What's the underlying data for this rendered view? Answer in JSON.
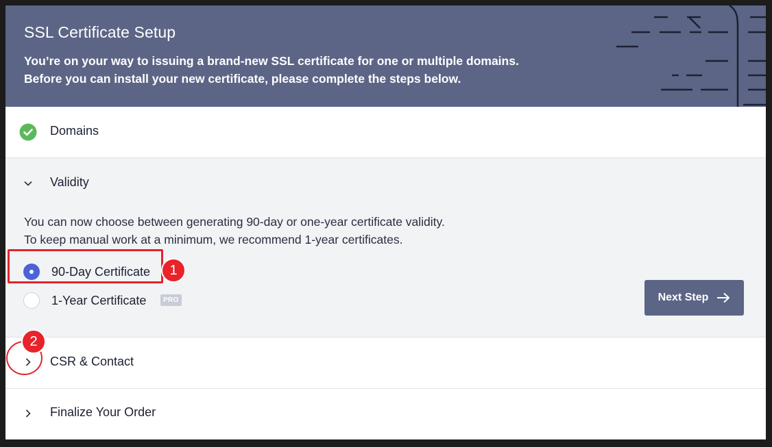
{
  "header": {
    "title": "SSL Certificate Setup",
    "desc_line1": "You’re on your way to issuing a brand-new SSL certificate for one or multiple domains.",
    "desc_line2": "Before you can install your new certificate, please complete the steps below."
  },
  "steps": {
    "domains": {
      "label": "Domains",
      "icon": "check-circle-icon",
      "status": "complete"
    },
    "validity": {
      "label": "Validity",
      "icon": "chevron-down-icon",
      "text_line1": "You can now choose between generating 90-day or one-year certificate validity.",
      "text_line2": "To keep manual work at a minimum, we recommend 1-year certificates.",
      "options": [
        {
          "label": "90-Day Certificate",
          "selected": true
        },
        {
          "label": "1-Year Certificate",
          "selected": false,
          "badge": "PRO"
        }
      ],
      "next_button": "Next Step"
    },
    "csr": {
      "label": "CSR & Contact",
      "icon": "chevron-right-icon"
    },
    "finalize": {
      "label": "Finalize Your Order",
      "icon": "chevron-right-icon"
    }
  },
  "annotations": {
    "marker1": "1",
    "marker2": "2"
  },
  "colors": {
    "header_bg": "#5c6585",
    "accent_blue": "#4a63d8",
    "success_green": "#5cb85c",
    "annotation_red": "#e0242c",
    "panel_bg": "#f2f3f5"
  }
}
